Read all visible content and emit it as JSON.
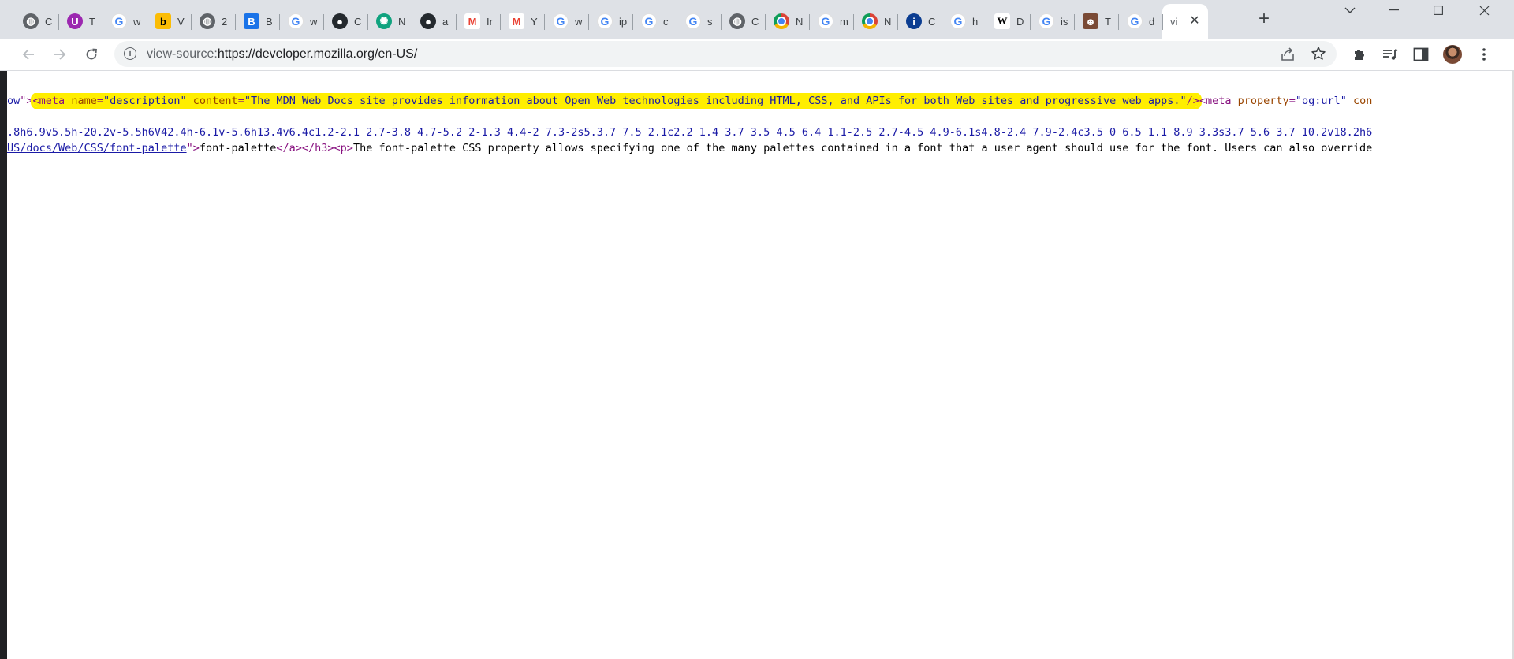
{
  "tabs": [
    {
      "title": "C",
      "icon": "globe-icon"
    },
    {
      "title": "T",
      "icon": "purple-u-icon"
    },
    {
      "title": "w",
      "icon": "google-icon"
    },
    {
      "title": "V",
      "icon": "yellow-icon"
    },
    {
      "title": "2",
      "icon": "globe-icon"
    },
    {
      "title": "B",
      "icon": "blue-b-icon"
    },
    {
      "title": "w",
      "icon": "google-icon"
    },
    {
      "title": "C",
      "icon": "github-icon"
    },
    {
      "title": "N",
      "icon": "chatgpt-icon"
    },
    {
      "title": "a",
      "icon": "github-icon"
    },
    {
      "title": "Ir",
      "icon": "gmail-icon"
    },
    {
      "title": "Y",
      "icon": "gmail-icon"
    },
    {
      "title": "w",
      "icon": "google-icon"
    },
    {
      "title": "ip",
      "icon": "google-icon"
    },
    {
      "title": "c",
      "icon": "google-icon"
    },
    {
      "title": "s",
      "icon": "google-icon"
    },
    {
      "title": "C",
      "icon": "globe-icon"
    },
    {
      "title": "N",
      "icon": "chrome-icon"
    },
    {
      "title": "m",
      "icon": "google-icon"
    },
    {
      "title": "N",
      "icon": "chrome-icon"
    },
    {
      "title": "C",
      "icon": "info-icon"
    },
    {
      "title": "h",
      "icon": "google-icon"
    },
    {
      "title": "D",
      "icon": "wikipedia-icon"
    },
    {
      "title": "is",
      "icon": "google-icon"
    },
    {
      "title": "T",
      "icon": "avatar-icon"
    },
    {
      "title": "d",
      "icon": "google-icon"
    },
    {
      "title": "vi",
      "icon": "",
      "active": true
    }
  ],
  "new_tab_label": "+",
  "close_symbol": "✕",
  "window_controls": {
    "dropdown": "⌵",
    "minimize": "—",
    "maximize": "☐",
    "close": "✕"
  },
  "toolbar": {
    "url_scheme": "view-source:",
    "url_rest": "https://developer.mozilla.org/en-US/",
    "info_symbol": "i"
  },
  "source": {
    "line1_pre_value": "ow",
    "line1_pre_close": "\">",
    "line1_hl_tag_open": "<meta",
    "line1_hl_attr_name": "name",
    "line1_hl_eq1": "=",
    "line1_hl_name_val": "\"description\"",
    "line1_hl_attr_content": "content",
    "line1_hl_eq2": "=",
    "line1_hl_content_val": "\"The MDN Web Docs site provides information about Open Web technologies including HTML, CSS, and APIs for both Web sites and progressive web apps.\"",
    "line1_hl_tag_close": "/>",
    "line1_post_tag_open": "<meta",
    "line1_post_attr": "property",
    "line1_post_eq": "=",
    "line1_post_val": "\"og:url\"",
    "line1_post_more": "con",
    "line2_path": ".8h6.9v5.5h-20.2v-5.5h6V42.4h-6.1v-5.6h13.4v6.4c1.2-2.1 2.7-3.8 4.7-5.2 2-1.3 4.4-2 7.3-2s5.3.7 7.5 2.1c2.2 1.4 3.7 3.5 4.5 6.4 1.1-2.5 2.7-4.5 4.9-6.1s4.8-2.4 7.9-2.4c3.5 0 6.5 1.1 8.9 3.3s3.7 5.6 3.7 10.2v18.2h6",
    "line3_link": "US/docs/Web/CSS/font-palette",
    "line3_close": "\">",
    "line3_text": "font-palette",
    "line3_tags": "</a></h3><p>",
    "line3_para": "The font-palette CSS property allows specifying one of the many palettes contained in a font that a user agent should use for the font. Users can also override"
  }
}
